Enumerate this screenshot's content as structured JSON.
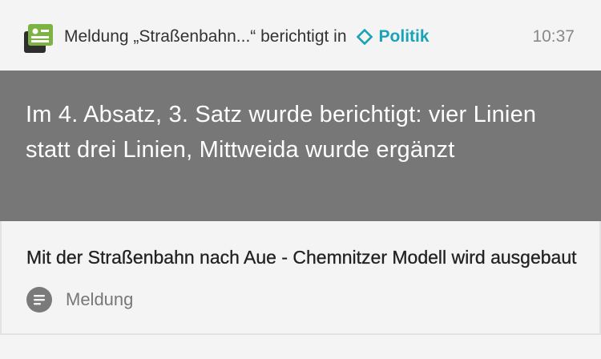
{
  "notification": {
    "message": "Meldung „Straßenbahn...“ berichtigt in",
    "category": "Politik",
    "time": "10:37",
    "colors": {
      "accent": "#1aa3b8",
      "icon_green": "#7cb342",
      "dark_gray": "#2e2e2e"
    },
    "icons": {
      "app": "newspaper-icon",
      "category": "diamond-icon"
    }
  },
  "correction": {
    "text": "Im 4. Absatz, 3. Satz wurde berichtigt: vier Linien statt drei Linien, Mittweida wurde ergänzt",
    "background": "#777777"
  },
  "article": {
    "title": "Mit der Straßenbahn nach Aue - Chemnitzer Modell wird ausgebaut",
    "type_label": "Meldung",
    "type_icon": "article-lines-icon"
  }
}
